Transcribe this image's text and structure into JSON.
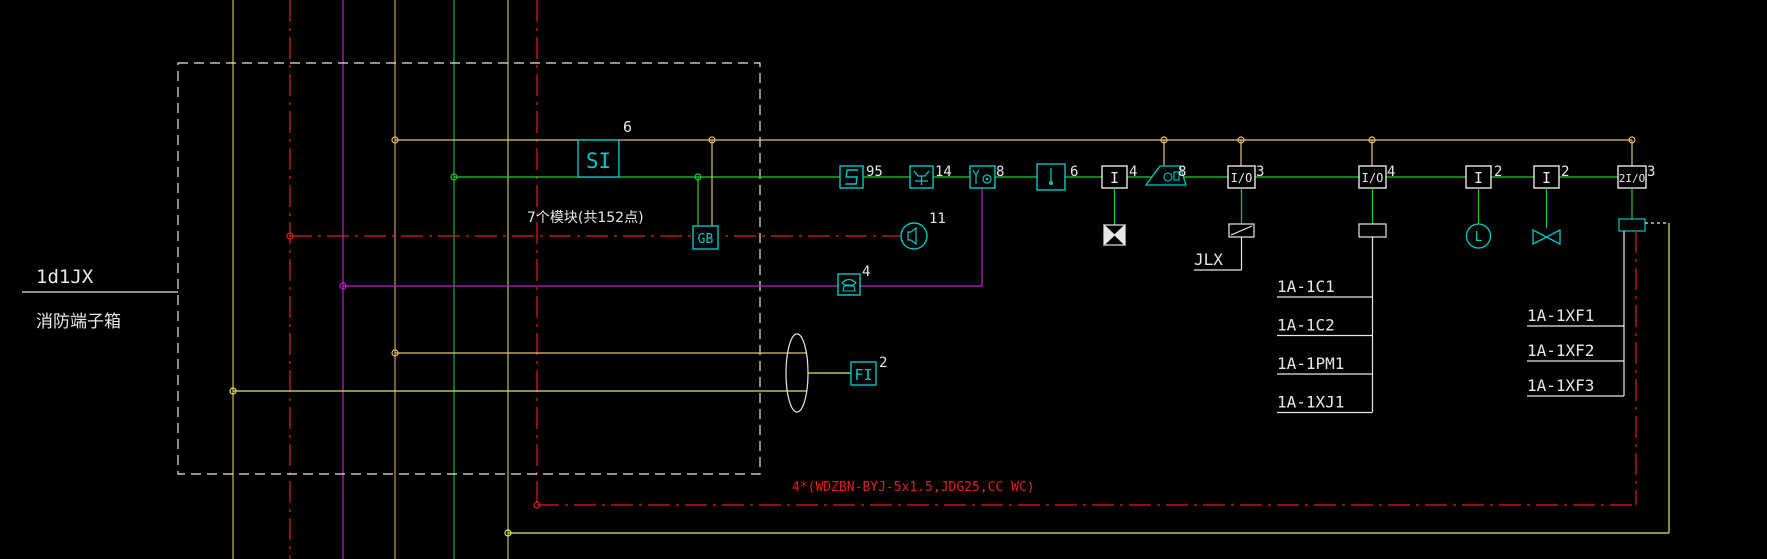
{
  "panel": {
    "id_label": "1d1JX",
    "name_label": "消防端子箱",
    "module_note": "7个模块(共152点)"
  },
  "devices": {
    "si": {
      "text": "SI",
      "count": "6"
    },
    "gb": {
      "text": "GB"
    },
    "fi": {
      "text": "FI",
      "count": "2"
    },
    "smoke": {
      "count": "95"
    },
    "heat": {
      "count": "14"
    },
    "combo": {
      "count": "8"
    },
    "speaker": {
      "count": "11"
    },
    "phone": {
      "count": "4"
    },
    "hydrant": {
      "count": "6"
    },
    "in_module_valve": {
      "text": "I",
      "count": "4"
    },
    "alarm_bell": {
      "count": "8"
    },
    "io_jlx": {
      "text": "I/O",
      "count": "3",
      "tag": "JLX"
    },
    "io_1a": {
      "text": "I/O",
      "count": "4"
    },
    "in_level": {
      "text": "I",
      "count": "2",
      "marker": "L"
    },
    "in_valve": {
      "text": "I",
      "count": "2"
    },
    "io_2": {
      "text": "2I/O",
      "count": "3"
    }
  },
  "io_1a_taps": [
    "1A-1C1",
    "1A-1C2",
    "1A-1PM1",
    "1A-1XJ1"
  ],
  "io_2_taps": [
    "1A-1XF1",
    "1A-1XF2",
    "1A-1XF3"
  ],
  "cable_note": "4*(WDZBN-BYJ-5x1.5,JDG25,CC WC)",
  "colors": {
    "background": "#000000",
    "cyan": "#00c8c8",
    "green": "#22cc33",
    "orange": "#e8c070",
    "yellow": "#e6e65a",
    "magenta": "#c01ec8",
    "red": "#e02020",
    "white": "#e8e8e8"
  }
}
